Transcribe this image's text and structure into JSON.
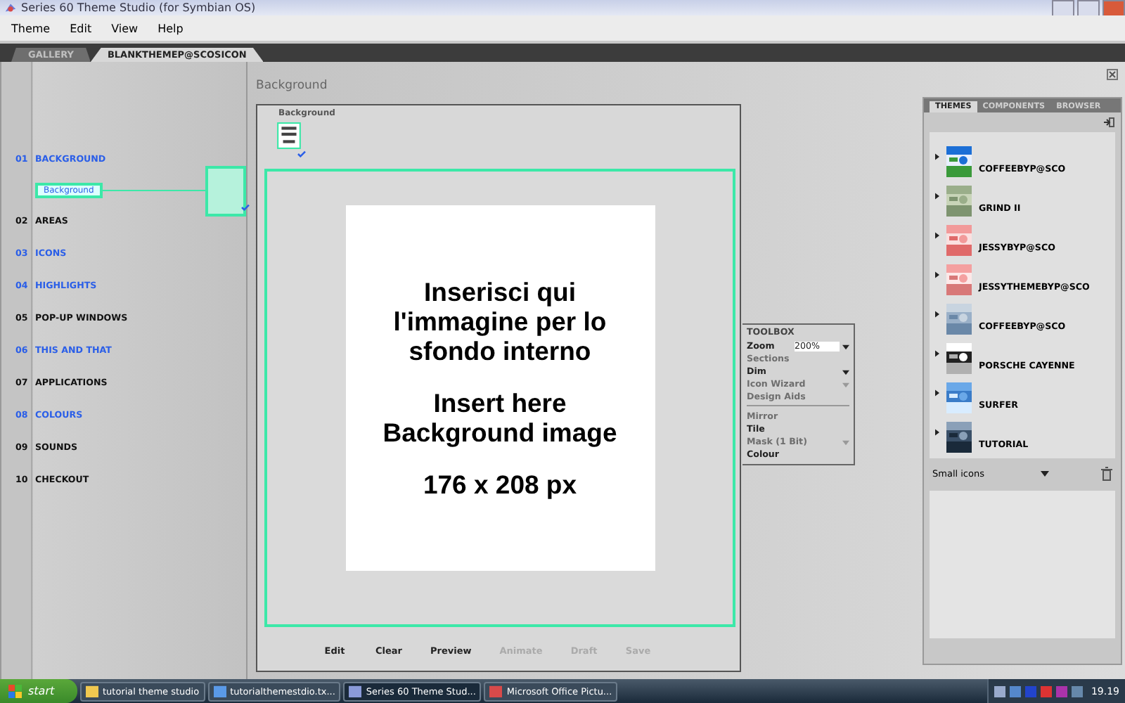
{
  "window": {
    "title": "Series 60 Theme Studio (for Symbian OS)"
  },
  "menu": [
    "Theme",
    "Edit",
    "View",
    "Help"
  ],
  "tabs": [
    {
      "label": "GALLERY",
      "selected": false,
      "disabled": true
    },
    {
      "label": "BLANKTHEMEP@SCOSICON",
      "selected": true,
      "disabled": false
    }
  ],
  "sections": [
    {
      "number": "01",
      "label": "BACKGROUND",
      "color": "#2a5ee8",
      "children": [
        {
          "label": "Background",
          "selected": true
        }
      ]
    },
    {
      "number": "02",
      "label": "AREAS",
      "color": "#111111"
    },
    {
      "number": "03",
      "label": "ICONS",
      "color": "#2a5ee8"
    },
    {
      "number": "04",
      "label": "HIGHLIGHTS",
      "color": "#2a5ee8"
    },
    {
      "number": "05",
      "label": "POP-UP WINDOWS",
      "color": "#111111"
    },
    {
      "number": "06",
      "label": "THIS AND THAT",
      "color": "#2a5ee8"
    },
    {
      "number": "07",
      "label": "APPLICATIONS",
      "color": "#111111"
    },
    {
      "number": "08",
      "label": "COLOURS",
      "color": "#2a5ee8"
    },
    {
      "number": "09",
      "label": "SOUNDS",
      "color": "#111111"
    },
    {
      "number": "10",
      "label": "CHECKOUT",
      "color": "#111111"
    }
  ],
  "editor": {
    "heading": "Background",
    "element_label": "Background",
    "image_lines": [
      "Inserisci qui",
      "l'immagine per lo",
      "sfondo interno"
    ],
    "image_lines_2": [
      "Insert here",
      "Background image"
    ],
    "image_size": "176 x 208 px"
  },
  "toolbox": {
    "title": "TOOLBOX",
    "items": [
      {
        "label": "Zoom",
        "kind": "field",
        "value": "200%",
        "disabled": false
      },
      {
        "label": "Sections",
        "kind": "plain",
        "disabled": true
      },
      {
        "label": "Dim",
        "kind": "dropdown",
        "disabled": false
      },
      {
        "label": "Icon Wizard",
        "kind": "dropdown",
        "disabled": true
      },
      {
        "label": "Design Aids",
        "kind": "plain",
        "disabled": true
      },
      {
        "label": "Mirror",
        "kind": "plain",
        "disabled": true
      },
      {
        "label": "Tile",
        "kind": "plain",
        "disabled": false
      },
      {
        "label": "Mask (1 Bit)",
        "kind": "dropdown",
        "disabled": true
      },
      {
        "label": "Colour",
        "kind": "plain",
        "disabled": false
      }
    ]
  },
  "actions": [
    {
      "label": "Edit",
      "disabled": false
    },
    {
      "label": "Clear",
      "disabled": false
    },
    {
      "label": "Preview",
      "disabled": false
    },
    {
      "label": "Animate",
      "disabled": true
    },
    {
      "label": "Draft",
      "disabled": true
    },
    {
      "label": "Save",
      "disabled": true
    }
  ],
  "panel": {
    "tabs": [
      {
        "label": "THEMES",
        "selected": true
      },
      {
        "label": "COMPONENTS",
        "selected": false
      },
      {
        "label": "BROWSER",
        "selected": false
      }
    ],
    "themes": [
      "COFFEEBYP@SCO",
      "GRIND II",
      "JESSYBYP@SCO",
      "JESSYTHEMEBYP@SCO",
      "COFFEEBYP@SCO",
      "PORSCHE CAYENNE",
      "SURFER",
      "TUTORIAL"
    ],
    "view": "Small icons"
  },
  "taskbar": {
    "start": "start",
    "tasks": [
      {
        "label": "tutorial theme studio",
        "selected": false
      },
      {
        "label": "tutorialthemestdio.tx...",
        "selected": false
      },
      {
        "label": "Series 60 Theme Stud...",
        "selected": true
      },
      {
        "label": "Microsoft Office Pictu...",
        "selected": false
      }
    ],
    "clock": "19.19"
  }
}
